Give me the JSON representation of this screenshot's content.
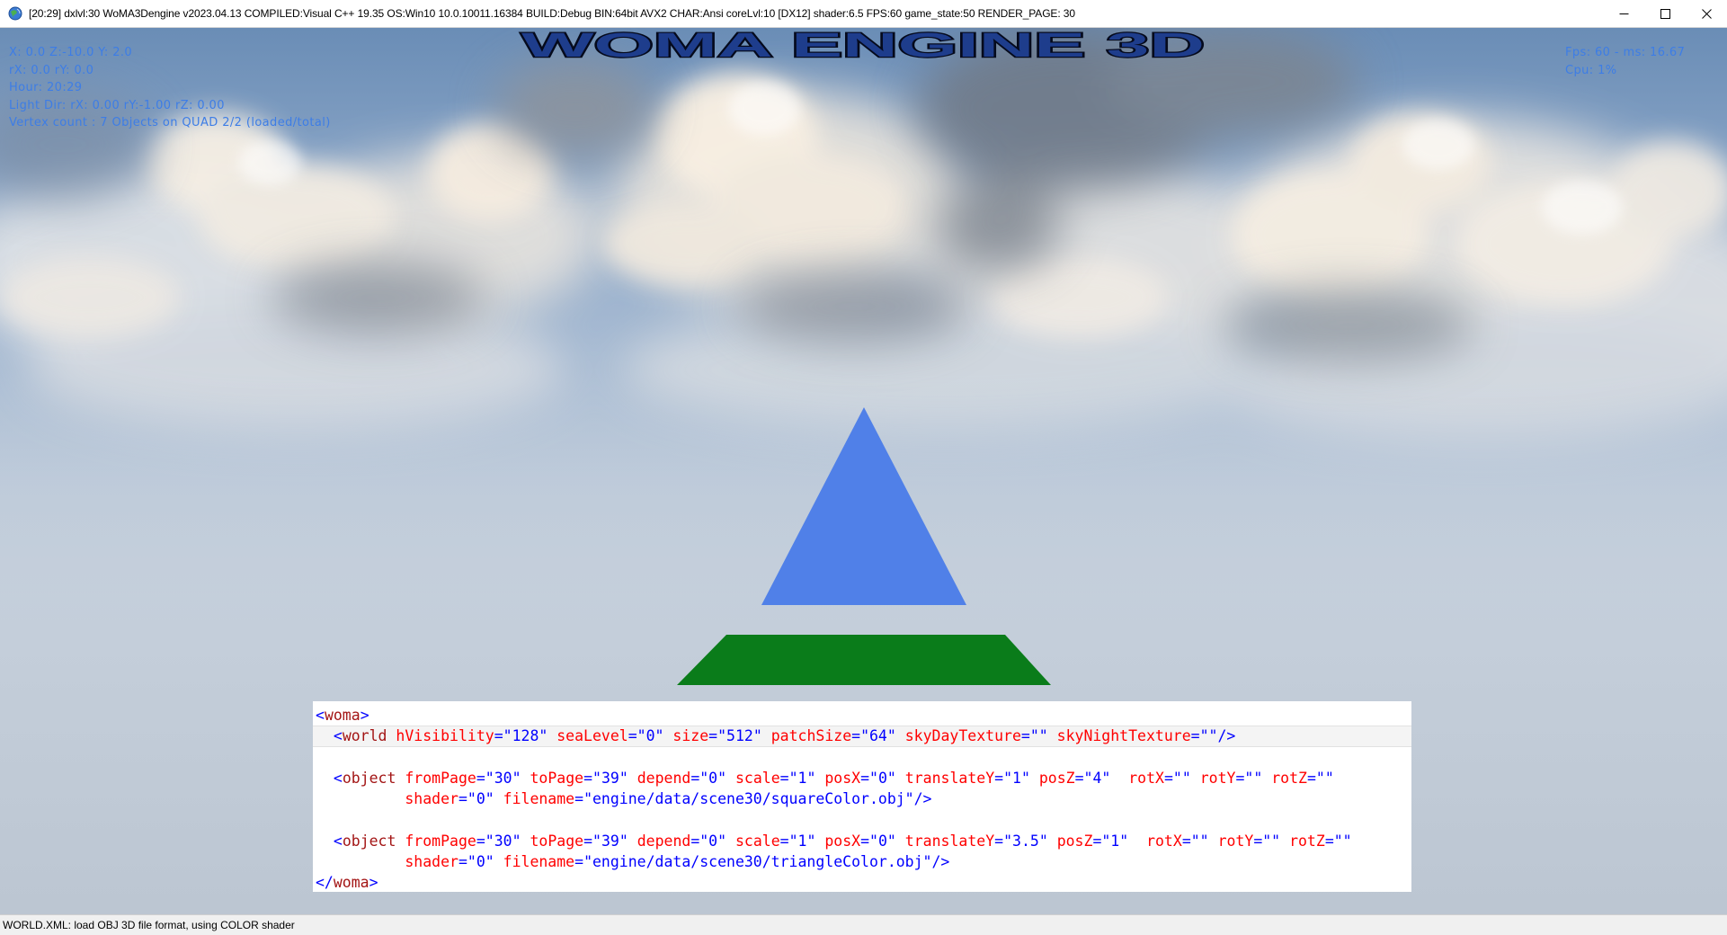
{
  "window": {
    "title": "[20:29] dxlvl:30 WoMA3Dengine v2023.04.13 COMPILED:Visual C++ 19.35 OS:Win10 10.0.10011.16384 BUILD:Debug BIN:64bit AVX2 CHAR:Ansi coreLvl:10 [DX12] shader:6.5 FPS:60 game_state:50 RENDER_PAGE: 30",
    "icon": "globe-icon",
    "controls": [
      "minimize-icon",
      "maximize-icon",
      "close-icon"
    ]
  },
  "logo": {
    "text": "WOMA ENGINE 3D"
  },
  "hud": {
    "left": [
      "X: 0.0 Z:-10.0 Y: 2.0",
      "rX: 0.0 rY: 0.0",
      "Hour: 20:29",
      "Light Dir: rX: 0.00 rY:-1.00 rZ: 0.00",
      "Vertex count : 7 Objects on QUAD 2/2 (loaded/total)"
    ],
    "right": [
      "Fps: 60 - ms: 16.67",
      "Cpu: 1%"
    ]
  },
  "scene": {
    "triangle_color": "#5080e8",
    "quad_color": "#0a7c1a"
  },
  "code": {
    "l1_open": "<",
    "l1_tag": "woma",
    "l1_close": ">",
    "l2_indent": "  ",
    "l2_open": "<",
    "l2_tag": "world",
    "l2_a1": "hVisibility",
    "l2_v1": "\"128\"",
    "l2_a2": "seaLevel",
    "l2_v2": "\"0\"",
    "l2_a3": "size",
    "l2_v3": "\"512\"",
    "l2_a4": "patchSize",
    "l2_v4": "\"64\"",
    "l2_a5": "skyDayTexture",
    "l2_v5": "\"\"",
    "l2_a6": "skyNightTexture",
    "l2_v6": "\"\"",
    "l2_end": "/>",
    "o1_open": "<",
    "o1_tag": "object",
    "o1_a1": "fromPage",
    "o1_v1": "\"30\"",
    "o1_a2": "toPage",
    "o1_v2": "\"39\"",
    "o1_a3": "depend",
    "o1_v3": "\"0\"",
    "o1_a4": "scale",
    "o1_v4": "\"1\"",
    "o1_a5": "posX",
    "o1_v5": "\"0\"",
    "o1_a6": "translateY",
    "o1_v6": "\"1\"",
    "o1_a7": "posZ",
    "o1_v7": "\"4\"",
    "o1_a8": "rotX",
    "o1_v8": "\"\"",
    "o1_a9": "rotY",
    "o1_v9": "\"\"",
    "o1_a10": "rotZ",
    "o1_v10": "\"\"",
    "o1_a11": "shader",
    "o1_v11": "\"0\"",
    "o1_a12": "filename",
    "o1_v12": "\"engine/data/scene30/squareColor.obj\"",
    "o1_end": "/>",
    "o2_open": "<",
    "o2_tag": "object",
    "o2_a1": "fromPage",
    "o2_v1": "\"30\"",
    "o2_a2": "toPage",
    "o2_v2": "\"39\"",
    "o2_a3": "depend",
    "o2_v3": "\"0\"",
    "o2_a4": "scale",
    "o2_v4": "\"1\"",
    "o2_a5": "posX",
    "o2_v5": "\"0\"",
    "o2_a6": "translateY",
    "o2_v6": "\"3.5\"",
    "o2_a7": "posZ",
    "o2_v7": "\"1\"",
    "o2_a8": "rotX",
    "o2_v8": "\"\"",
    "o2_a9": "rotY",
    "o2_v9": "\"\"",
    "o2_a10": "rotZ",
    "o2_v10": "\"\"",
    "o2_a11": "shader",
    "o2_v11": "\"0\"",
    "o2_a12": "filename",
    "o2_v12": "\"engine/data/scene30/triangleColor.obj\"",
    "o2_end": "/>",
    "end_open": "</",
    "end_tag": "woma",
    "end_close": ">"
  },
  "status": {
    "text": "WORLD.XML: load OBJ 3D file format, using COLOR shader"
  }
}
